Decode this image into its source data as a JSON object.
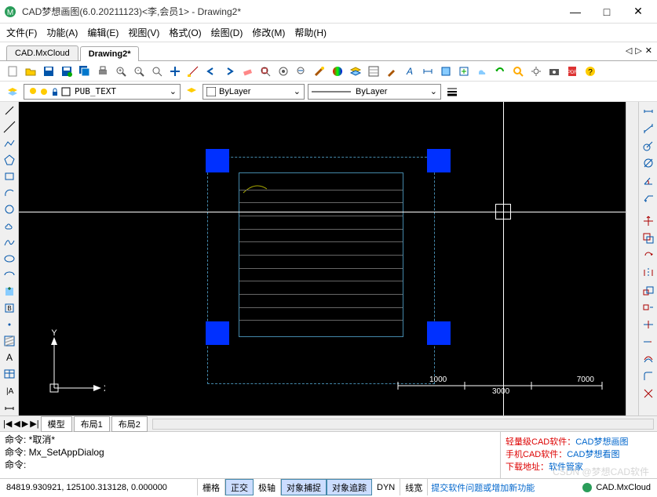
{
  "window": {
    "title": "CAD梦想画图(6.0.20211123)<李,会员1> - Drawing2*",
    "min": "—",
    "max": "□",
    "close": "✕"
  },
  "menu": [
    "文件(F)",
    "功能(A)",
    "编辑(E)",
    "视图(V)",
    "格式(O)",
    "绘图(D)",
    "修改(M)",
    "帮助(H)"
  ],
  "doctabs": {
    "items": [
      "CAD.MxCloud",
      "Drawing2*"
    ],
    "active": 1,
    "left": "◁",
    "right": "▷",
    "x": "✕"
  },
  "props": {
    "layer": "PUB_TEXT",
    "color": "ByLayer",
    "ltype": "ByLayer"
  },
  "bottabs": {
    "nav": [
      "|◀",
      "◀",
      "▶",
      "▶|"
    ],
    "items": [
      "模型",
      "布局1",
      "布局2"
    ]
  },
  "cmd": {
    "l1": "命令:  *取消*",
    "l2": "命令: Mx_SetAppDialog",
    "l3": "命令:"
  },
  "ad": {
    "r1a": "轻量级CAD软件：",
    "r1b": "CAD梦想画图",
    "r2a": "手机CAD软件：",
    "r2b": "CAD梦想看图",
    "r3a": "下载地址：",
    "r3b": "软件管家"
  },
  "status": {
    "coords": "84819.930921,  125100.313128,  0.000000",
    "cells": [
      "栅格",
      "正交",
      "极轴",
      "对象捕捉",
      "对象追踪",
      "DYN",
      "线宽"
    ],
    "active": [
      1,
      3,
      4
    ],
    "link": "提交软件问题或增加新功能",
    "brand": "CAD.MxCloud"
  },
  "scale": {
    "t1": "1000",
    "t2": "3000",
    "t3": "7000"
  },
  "ucs": {
    "x": "X",
    "y": "Y"
  },
  "watermark": "CSDN @梦想CAD软件",
  "icons": {
    "new": "#4a8",
    "open": "#c90",
    "save": "#05a",
    "print": "#555",
    "undo": "#05a",
    "redo": "#05a",
    "cut": "#a55",
    "copy": "#58a",
    "paste": "#8a5"
  }
}
